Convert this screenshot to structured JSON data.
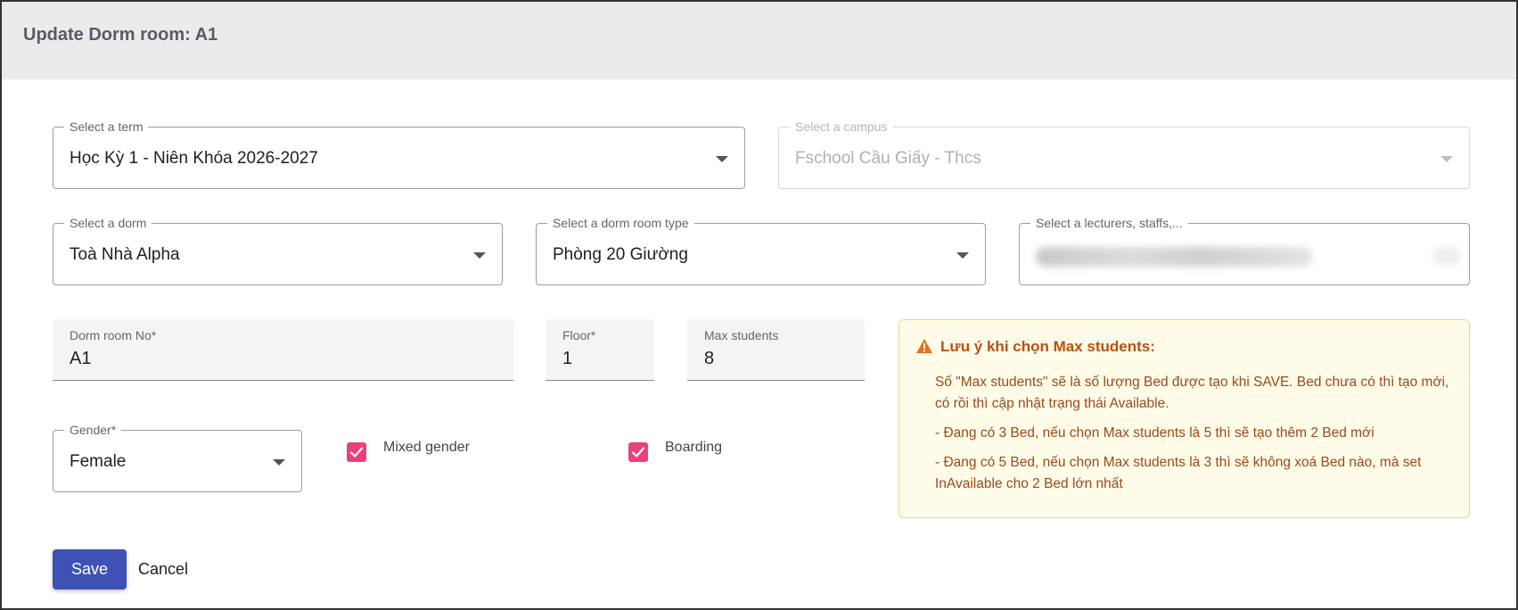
{
  "header": {
    "title": "Update Dorm room: A1"
  },
  "form": {
    "term": {
      "label": "Select a term",
      "value": "Học Kỳ 1 - Niên Khóa 2026-2027"
    },
    "campus": {
      "label": "Select a campus",
      "value": "Fschool Cầu Giấy - Thcs"
    },
    "dorm": {
      "label": "Select a dorm",
      "value": "Toà Nhà Alpha"
    },
    "room_type": {
      "label": "Select a dorm room type",
      "value": "Phòng 20 Giường"
    },
    "lecturers": {
      "label": "Select a lecturers, staffs,..."
    },
    "dorm_room_no": {
      "label": "Dorm room No*",
      "value": "A1"
    },
    "floor": {
      "label": "Floor*",
      "value": "1"
    },
    "max_students": {
      "label": "Max students",
      "value": "8"
    },
    "gender": {
      "label": "Gender*",
      "value": "Female"
    },
    "mixed_gender": {
      "label": "Mixed gender",
      "checked": true
    },
    "boarding": {
      "label": "Boarding",
      "checked": true
    }
  },
  "warning": {
    "title": "Lưu ý khi chọn Max students:",
    "lines": [
      "Số \"Max students\" sẽ là số lượng Bed được tạo khi SAVE. Bed chưa có thì tạo mới, có rồi thì cập nhật trạng thái Available.",
      "- Đang có 3 Bed, nếu chọn Max students là 5 thì sẽ tạo thêm 2 Bed mới",
      "- Đang có 5 Bed, nếu chọn Max students là 3 thì sẽ không xoá Bed nào, mà set InAvailable cho 2 Bed lớn nhất"
    ]
  },
  "actions": {
    "save_label": "Save",
    "cancel_label": "Cancel"
  },
  "colors": {
    "primary": "#3f51b5",
    "checkbox": "#ec407a",
    "warning_bg": "#fffbe9",
    "warning_text": "#b9510d",
    "header_bg": "#ebebed"
  },
  "icons": {
    "warning": "warning-triangle-icon",
    "dropdown": "caret-down-icon",
    "check": "check-icon"
  }
}
